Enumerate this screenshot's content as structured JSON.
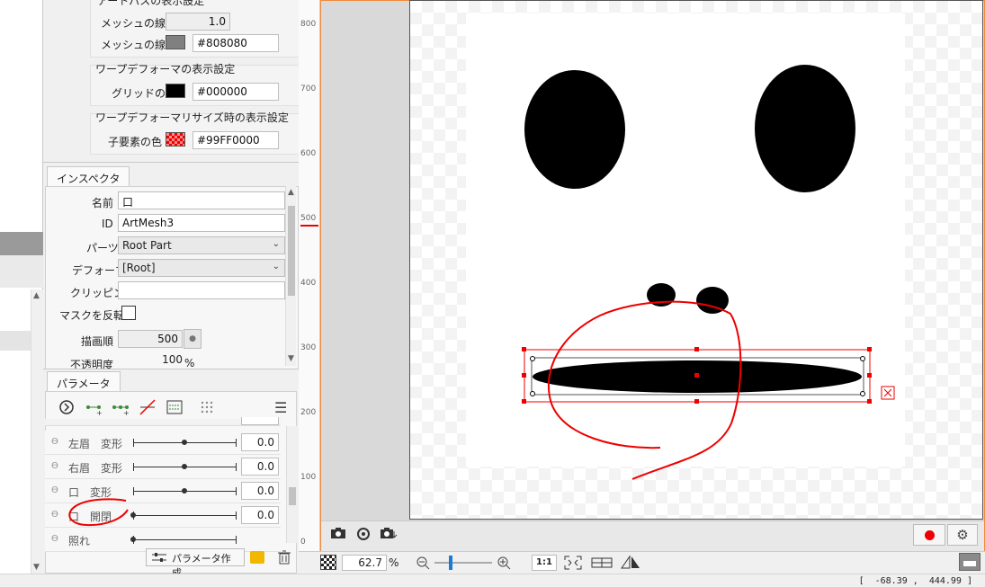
{
  "display_settings": {
    "section_title_partial": "アートパスの表示設定",
    "mesh_line_width_label": "メッシュの線幅",
    "mesh_line_width_value": "1.0",
    "mesh_line_color_label": "メッシュの線色",
    "mesh_line_color_value": "#808080",
    "warp_title": "ワープデフォーマの表示設定",
    "grid_color_label": "グリッドの色",
    "grid_color_value": "#000000",
    "warp_resize_title": "ワープデフォーマリサイズ時の表示設定",
    "child_color_label": "子要素の色",
    "child_color_value": "#99FF0000"
  },
  "inspector": {
    "tab": "インスペクタ",
    "name_label": "名前",
    "name_value": "口",
    "id_label": "ID",
    "id_value": "ArtMesh3",
    "parts_label": "パーツ",
    "parts_value": "Root Part",
    "deformer_label": "デフォーマ",
    "deformer_value": "[Root]",
    "clipping_label": "クリッピング",
    "clipping_value": "",
    "invert_mask_label": "マスクを反転",
    "draw_order_label": "描画順",
    "draw_order_value": "500",
    "opacity_label": "不透明度",
    "opacity_value": "100",
    "opacity_unit": "%"
  },
  "parameters": {
    "tab": "パラメータ",
    "rows": [
      {
        "name": "左眉　変形",
        "value": "0.0",
        "level": 0.5
      },
      {
        "name": "右眉　変形",
        "value": "0.0",
        "level": 0.5
      },
      {
        "name": "口　変形",
        "value": "0.0",
        "level": 0.5
      },
      {
        "name": "口　開閉",
        "value": "0.0",
        "level": 0.0
      },
      {
        "name": "照れ",
        "value": "",
        "level": 0.0
      }
    ],
    "create_button": "パラメータ作成"
  },
  "ruler": {
    "ticks": [
      "800",
      "700",
      "600",
      "500",
      "400",
      "300",
      "200",
      "100",
      "0"
    ]
  },
  "status": {
    "zoom_value": "62.7",
    "zoom_unit": "%",
    "one_to_one": "1:1",
    "coords": "[  -68.39 ,  444.99 ]"
  },
  "colors": {
    "accent": "#f08a3c",
    "selection": "#e00000",
    "annotation": "#e00000"
  },
  "icons": [
    "camera-icon",
    "camera-refresh-icon",
    "camera-down-icon",
    "record-icon",
    "gear-icon",
    "zoom-out-icon",
    "zoom-in-icon",
    "fit-icon",
    "grid-icon",
    "flip-icon",
    "folder-icon",
    "trash-icon",
    "menu-icon",
    "play-icon"
  ]
}
